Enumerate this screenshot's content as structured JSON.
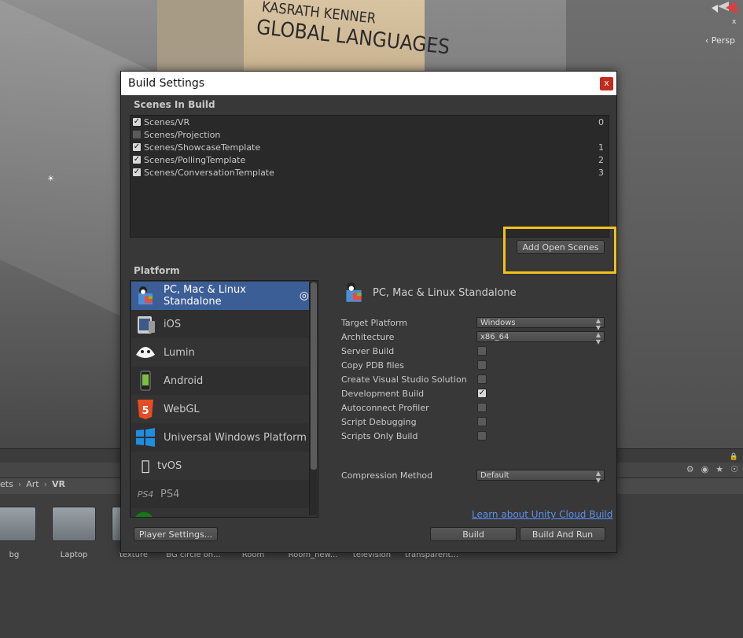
{
  "scene_view": {
    "box_text_line1": "KASRATH KENNER",
    "box_text_line2": "GLOBAL LANGUAGES",
    "persp_label": "Persp"
  },
  "project": {
    "breadcrumb": [
      "ets",
      "Art",
      "VR"
    ],
    "assets": [
      {
        "label": "bg"
      },
      {
        "label": "Laptop"
      },
      {
        "label": "texture"
      },
      {
        "label": "BG circle on..."
      },
      {
        "label": "Room"
      },
      {
        "label": "Room_new..."
      },
      {
        "label": "television"
      },
      {
        "label": "transparent..."
      }
    ]
  },
  "window": {
    "title": "Build Settings",
    "close_glyph": "x",
    "scenes_title": "Scenes In Build",
    "scenes": [
      {
        "name": "Scenes/VR",
        "checked": true,
        "index": "0"
      },
      {
        "name": "Scenes/Projection",
        "checked": false,
        "index": ""
      },
      {
        "name": "Scenes/ShowcaseTemplate",
        "checked": true,
        "index": "1"
      },
      {
        "name": "Scenes/PollingTemplate",
        "checked": true,
        "index": "2"
      },
      {
        "name": "Scenes/ConversationTemplate",
        "checked": true,
        "index": "3"
      }
    ],
    "add_open_scenes_label": "Add Open Scenes",
    "platform_title": "Platform",
    "platforms": [
      {
        "label": "PC, Mac & Linux Standalone",
        "icon": "pc-icon",
        "selected": true
      },
      {
        "label": "iOS",
        "icon": "ios-icon"
      },
      {
        "label": "Lumin",
        "icon": "lumin-icon"
      },
      {
        "label": "Android",
        "icon": "android-icon"
      },
      {
        "label": "WebGL",
        "icon": "html5-icon"
      },
      {
        "label": "Universal Windows Platform",
        "icon": "windows-icon"
      },
      {
        "label": "tvOS",
        "icon": "appletv-icon"
      },
      {
        "label": "PS4",
        "icon": "ps4-icon"
      }
    ],
    "selected_platform_title": "PC, Mac & Linux Standalone",
    "settings": {
      "target_platform_label": "Target Platform",
      "target_platform_value": "Windows",
      "architecture_label": "Architecture",
      "architecture_value": "x86_64",
      "server_build_label": "Server Build",
      "copy_pdb_label": "Copy PDB files",
      "create_vs_label": "Create Visual Studio Solution",
      "development_build_label": "Development Build",
      "autoconnect_label": "Autoconnect Profiler",
      "script_debugging_label": "Script Debugging",
      "scripts_only_label": "Scripts Only Build",
      "compression_label": "Compression Method",
      "compression_value": "Default"
    },
    "checkbox_states": {
      "server_build": false,
      "copy_pdb": false,
      "create_vs": false,
      "development_build": true,
      "autoconnect": false,
      "script_debugging": false,
      "scripts_only": false
    },
    "learn_link": "Learn about Unity Cloud Build",
    "player_settings_label": "Player Settings...",
    "build_label": "Build",
    "build_and_run_label": "Build And Run"
  },
  "colors": {
    "selection": "#3c5e96",
    "highlight": "#f2c21b",
    "link": "#5a8ff0",
    "close": "#c42b1c"
  }
}
